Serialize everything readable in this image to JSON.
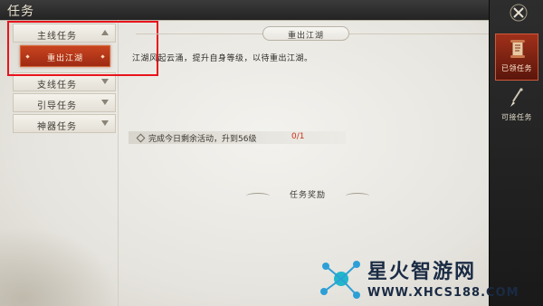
{
  "window": {
    "title": "任务"
  },
  "categories": [
    {
      "label": "主线任务",
      "expanded": true
    },
    {
      "label": "支线任务",
      "expanded": false
    },
    {
      "label": "引导任务",
      "expanded": false
    },
    {
      "label": "神器任务",
      "expanded": false
    }
  ],
  "selected_quest": {
    "label": "重出江湖"
  },
  "quest": {
    "title": "重出江湖",
    "description": "江湖风起云涌，提升自身等级，以待重出江湖。",
    "objective": "完成今日剩余活动，升到56级",
    "progress": "0/1",
    "reward_header": "任务奖励"
  },
  "tabs": [
    {
      "label": "已领任务",
      "icon": "scroll-icon",
      "active": true
    },
    {
      "label": "可接任务",
      "icon": "brush-icon",
      "active": false
    }
  ],
  "close_icon": "close-icon",
  "watermark": {
    "text": "星火智游网",
    "url": "WWW.XHCS188.COM"
  },
  "colors": {
    "accent": "#b4371b",
    "progress": "#c8321a",
    "highlight": "#e8131c"
  }
}
